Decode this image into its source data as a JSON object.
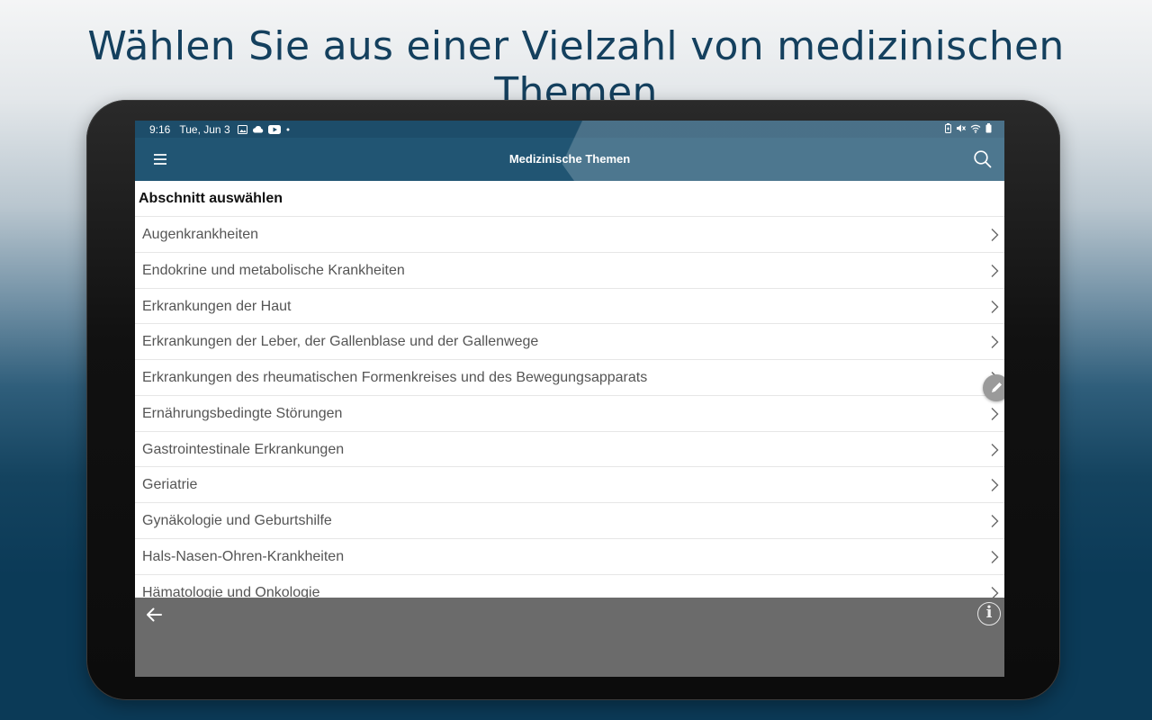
{
  "headline": "Wählen Sie aus einer Vielzahl von medizinischen Themen",
  "statusbar": {
    "time": "9:16",
    "date": "Tue, Jun 3",
    "icons_left": [
      "image-icon",
      "cloud-icon",
      "youtube-icon",
      "dot-icon"
    ],
    "icons_right": [
      "battery-saver-icon",
      "mute-icon",
      "wifi-icon",
      "battery-icon"
    ]
  },
  "appbar": {
    "title": "Medizinische Themen",
    "menu_icon": "hamburger-menu-icon",
    "search_icon": "search-icon"
  },
  "section_header": "Abschnitt auswählen",
  "list": {
    "items": [
      {
        "label": "Augenkrankheiten"
      },
      {
        "label": "Endokrine und metabolische Krankheiten"
      },
      {
        "label": "Erkrankungen der Haut"
      },
      {
        "label": "Erkrankungen der Leber, der Gallenblase und der Gallenwege"
      },
      {
        "label": "Erkrankungen des rheumatischen Formenkreises und des Bewegungsapparats"
      },
      {
        "label": "Ernährungsbedingte Störungen"
      },
      {
        "label": "Gastrointestinale Erkrankungen"
      },
      {
        "label": "Geriatrie"
      },
      {
        "label": "Gynäkologie und Geburtshilfe"
      },
      {
        "label": "Hals-Nasen-Ohren-Krankheiten"
      },
      {
        "label": "Hämatologie und Onkologie"
      }
    ]
  },
  "bottombar": {
    "back_icon": "arrow-left-icon",
    "info_icon": "info-icon",
    "info_glyph": "i"
  },
  "colors": {
    "appbar": "#215573",
    "statusbar": "#1d4d6a",
    "headline": "#14405e",
    "bottombar": "#6b6b6b"
  }
}
